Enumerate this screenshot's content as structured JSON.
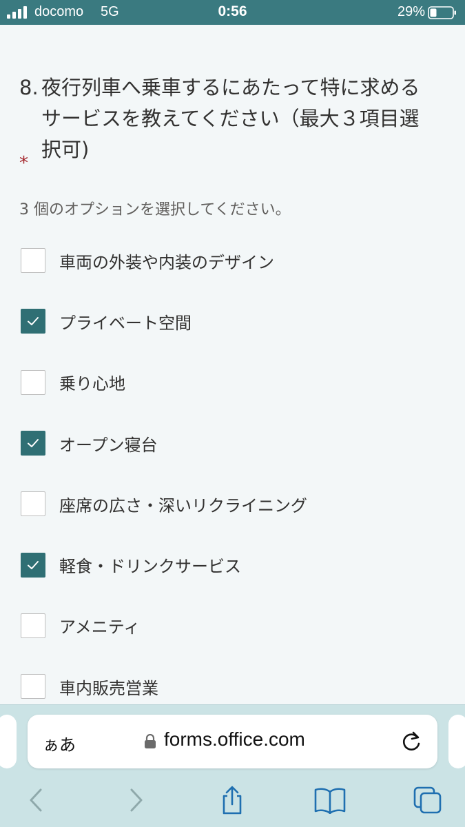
{
  "status_bar": {
    "carrier": "docomo",
    "network": "5G",
    "time": "0:56",
    "battery_percent": "29%",
    "battery_level": 0.29
  },
  "question": {
    "number": "8.",
    "text": "夜行列車へ乗車するにあたって特に求めるサービスを教えてください（最大３項目選択可)",
    "required_mark": "*",
    "hint": "3 個のオプションを選択してください。"
  },
  "options": [
    {
      "label": "車両の外装や内装のデザイン",
      "checked": false
    },
    {
      "label": "プライベート空間",
      "checked": true
    },
    {
      "label": "乗り心地",
      "checked": false
    },
    {
      "label": "オープン寝台",
      "checked": true
    },
    {
      "label": "座席の広さ・深いリクライニング",
      "checked": false
    },
    {
      "label": "軽食・ドリンクサービス",
      "checked": true
    },
    {
      "label": "アメニティ",
      "checked": false
    },
    {
      "label": "車内販売営業",
      "checked": false
    }
  ],
  "browser": {
    "text_size_label": "ぁあ",
    "url": "forms.office.com",
    "accent_color": "#2f6f74"
  }
}
